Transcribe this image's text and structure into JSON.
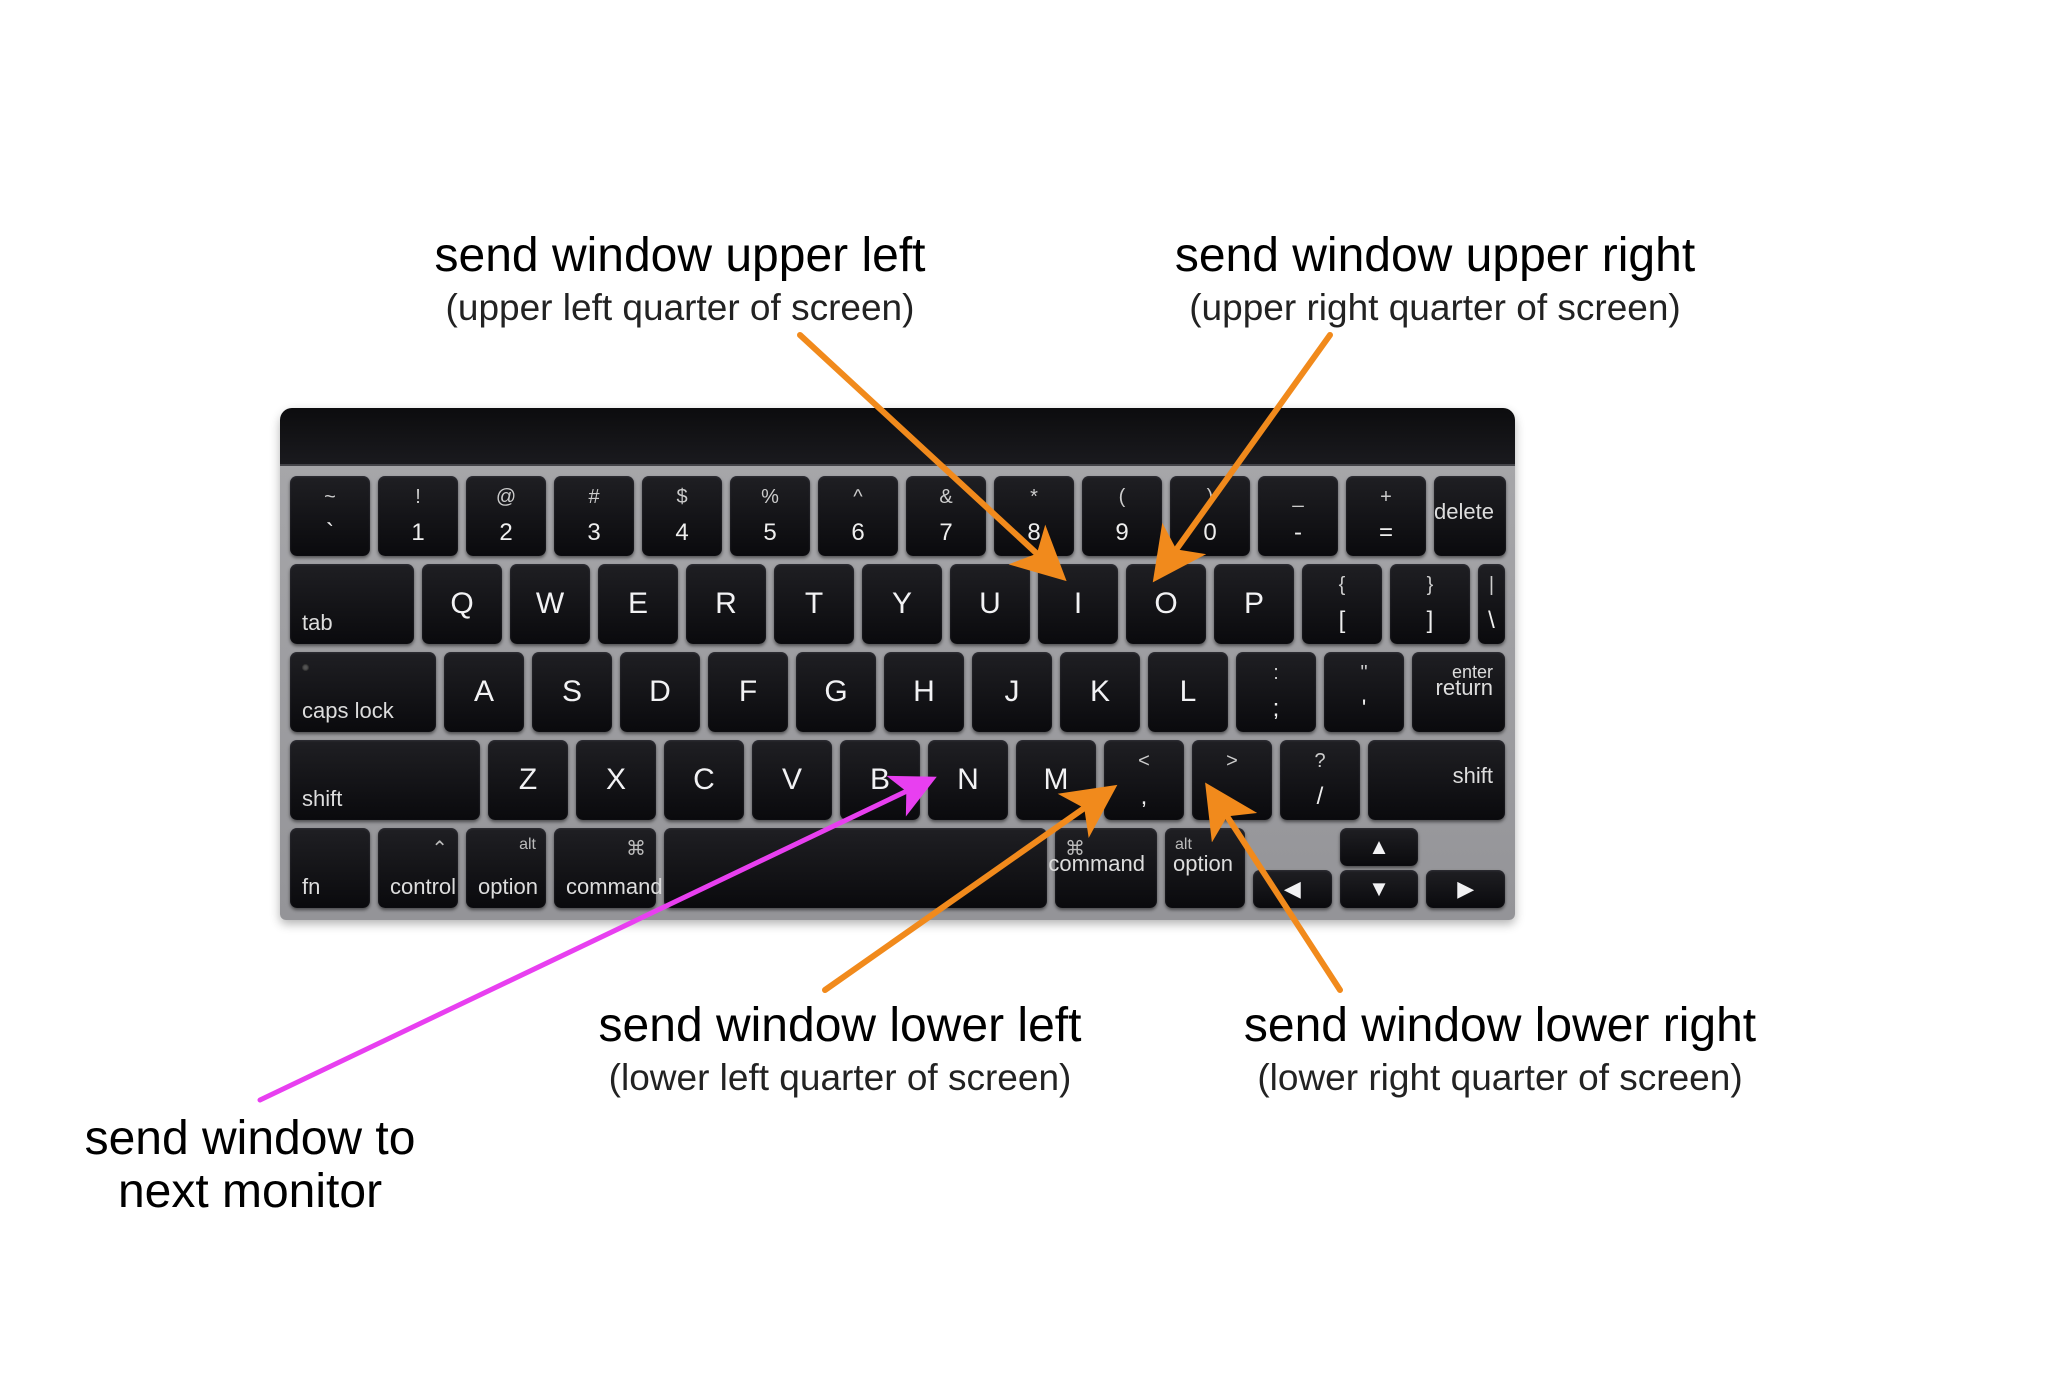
{
  "annotations": {
    "upper_left": {
      "title": "send window upper left",
      "sub": "(upper left quarter of screen)"
    },
    "upper_right": {
      "title": "send window upper right",
      "sub": "(upper right quarter of screen)"
    },
    "lower_left": {
      "title": "send window lower left",
      "sub": "(lower left quarter of screen)"
    },
    "lower_right": {
      "title": "send window lower right",
      "sub": "(lower right quarter of screen)"
    },
    "next_monitor": {
      "title": "send window to\nnext monitor"
    }
  },
  "keyboard": {
    "row1": [
      {
        "top": "~",
        "bot": "`"
      },
      {
        "top": "!",
        "bot": "1"
      },
      {
        "top": "@",
        "bot": "2"
      },
      {
        "top": "#",
        "bot": "3"
      },
      {
        "top": "$",
        "bot": "4"
      },
      {
        "top": "%",
        "bot": "5"
      },
      {
        "top": "^",
        "bot": "6"
      },
      {
        "top": "&",
        "bot": "7"
      },
      {
        "top": "*",
        "bot": "8"
      },
      {
        "top": "(",
        "bot": "9"
      },
      {
        "top": ")",
        "bot": "0"
      },
      {
        "top": "_",
        "bot": "-"
      },
      {
        "top": "+",
        "bot": "="
      }
    ],
    "delete_label": "delete",
    "tab_label": "tab",
    "row2_letters": [
      "Q",
      "W",
      "E",
      "R",
      "T",
      "Y",
      "U",
      "I",
      "O",
      "P"
    ],
    "row2_tail": [
      {
        "top": "{",
        "bot": "["
      },
      {
        "top": "}",
        "bot": "]"
      },
      {
        "top": "|",
        "bot": "\\"
      }
    ],
    "caps_label": "caps lock",
    "row3_letters": [
      "A",
      "S",
      "D",
      "F",
      "G",
      "H",
      "J",
      "K",
      "L"
    ],
    "row3_tail": [
      {
        "top": ":",
        "bot": ";"
      },
      {
        "top": "\"",
        "bot": "'"
      }
    ],
    "enter_top": "enter",
    "enter_bot": "return",
    "shift_label": "shift",
    "row4_letters": [
      "Z",
      "X",
      "C",
      "V",
      "B",
      "N",
      "M"
    ],
    "row4_tail": [
      {
        "top": "<",
        "bot": ","
      },
      {
        "top": ">",
        "bot": "."
      },
      {
        "top": "?",
        "bot": "/"
      }
    ],
    "fn_label": "fn",
    "control_label": "control",
    "control_icon": "⌃",
    "option_label": "option",
    "option_alt": "alt",
    "command_label": "command",
    "command_icon": "⌘",
    "arrows": {
      "up": "▲",
      "left": "◀",
      "down": "▼",
      "right": "▶"
    }
  },
  "colors": {
    "orange": "#f18a1c",
    "magenta": "#e83ff0"
  }
}
